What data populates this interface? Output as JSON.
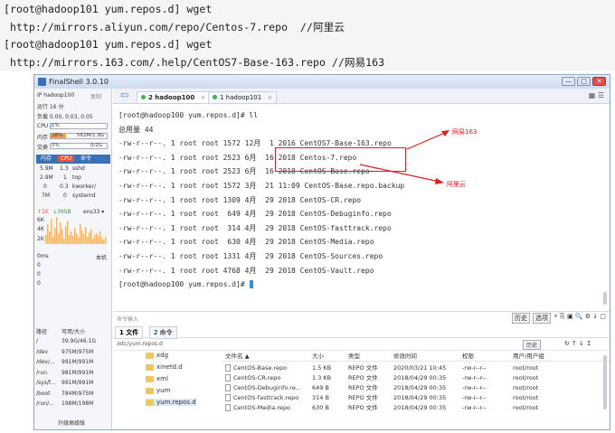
{
  "commands": [
    "[root@hadoop101 yum.repos.d] wget",
    " http://mirrors.aliyun.com/repo/Centos-7.repo  //阿里云",
    "[root@hadoop101 yum.repos.d] wget",
    " http://mirrors.163.com/.help/CentOS7-Base-163.repo //网易163"
  ],
  "window": {
    "title": "FinalShell 3.0.10",
    "min": "—",
    "max": "□",
    "close": "✕"
  },
  "sidebar": {
    "host": "IP hadoop100",
    "copy": "复制",
    "uptime": "运行 16 分",
    "load": "负载 0.00, 0.03, 0.05",
    "cpu_label": "CPU",
    "cpu_value": "1%",
    "cpu_pct": 1,
    "mem_label": "内存",
    "mem_pct_text": "28%",
    "mem_value": "562M/1.9G",
    "mem_pct": 28,
    "swap_label": "交换",
    "swap_pct_text": "0%",
    "swap_value": "0/2G",
    "swap_pct": 0,
    "proc_headers": [
      "内存",
      "CPU",
      "命令"
    ],
    "processes": [
      {
        "mem": "5.9M",
        "cpu": "1.3",
        "cmd": "sshd"
      },
      {
        "mem": "2.9M",
        "cpu": "1",
        "cmd": "top"
      },
      {
        "mem": "0",
        "cpu": "0.3",
        "cmd": "kworker/"
      },
      {
        "mem": "7M",
        "cpu": "0",
        "cmd": "systemd"
      }
    ],
    "net_up": "↑1K",
    "net_down": "↓395B",
    "net_if": "ens33 ▾",
    "net_scale": [
      "6K",
      "4K",
      "2K"
    ],
    "ping_label": "0ms",
    "ping_host": "本机",
    "ping_scale": [
      "0",
      "0",
      "0"
    ]
  },
  "tabs": [
    {
      "label": "2 hadoop100",
      "close": "×"
    },
    {
      "label": "1 hadoop101",
      "close": "×"
    }
  ],
  "terminal": {
    "lines": [
      "[root@hadoop100 yum.repos.d]# ll",
      "总用量 44",
      "-rw-r--r--. 1 root root 1572 12月  1 2016 CentOS7-Base-163.repo",
      "-rw-r--r--. 1 root root 2523 6月  16 2018 Centos-7.repo",
      "-rw-r--r--. 1 root root 2523 6月  16 2018 CentOS-Base.repo",
      "-rw-r--r--. 1 root root 1572 3月  21 11:09 CentOS-Base.repo.backup",
      "-rw-r--r--. 1 root root 1309 4月  29 2018 CentOS-CR.repo",
      "-rw-r--r--. 1 root root  649 4月  29 2018 CentOS-Debuginfo.repo",
      "-rw-r--r--. 1 root root  314 4月  29 2018 CentOS-fasttrack.repo",
      "-rw-r--r--. 1 root root  630 4月  29 2018 CentOS-Media.repo",
      "-rw-r--r--. 1 root root 1331 4月  29 2018 CentOS-Sources.repo",
      "-rw-r--r--. 1 root root 4768 4月  29 2018 CentOS-Vault.repo",
      "[root@hadoop100 yum.repos.d]# "
    ],
    "annotation_163": "网易163",
    "annotation_aliyun": "阿里云",
    "annotation_color": "#e02020"
  },
  "cmd_input": {
    "placeholder": "命令输入",
    "history": "历史",
    "options": "选项",
    "icons": "⚡ ⎘ ▣ 🔍 ⚙ ↓ ▢"
  },
  "file_tabs": [
    "1 文件",
    "2 命令"
  ],
  "path": {
    "value": "/etc/yum.repos.d",
    "history": "历史",
    "icons": "↻ ↑ ↓ ↥"
  },
  "disks": {
    "headers": [
      "路径",
      "可用/大小"
    ],
    "rows": [
      {
        "path": "/",
        "size": "39.9G/46.1G"
      },
      {
        "path": "/dev",
        "size": "975M/975M"
      },
      {
        "path": "/dev/...",
        "size": "991M/991M"
      },
      {
        "path": "/run",
        "size": "981M/991M"
      },
      {
        "path": "/sys/f...",
        "size": "991M/991M"
      },
      {
        "path": "/boot",
        "size": "784M/975M"
      },
      {
        "path": "/run/...",
        "size": "198M/198M"
      }
    ],
    "upgrade": "升级高级版"
  },
  "tree": [
    "xdg",
    "xinetd.d",
    "xml",
    "yum",
    "yum.repos.d"
  ],
  "files": {
    "headers": [
      "文件名 ▲",
      "大小",
      "类型",
      "修改时间",
      "权限",
      "用户/用户组"
    ],
    "rows": [
      [
        "CentOS-Base.repo",
        "1.5 KB",
        "REPO 文件",
        "2020/03/21 10:45",
        "-rw-r--r--",
        "root/root"
      ],
      [
        "CentOS-CR.repo",
        "1.3 KB",
        "REPO 文件",
        "2018/04/29 00:35",
        "-rw-r--r--",
        "root/root"
      ],
      [
        "CentOS-Debuginfo.re...",
        "649 B",
        "REPO 文件",
        "2018/04/29 00:35",
        "-rw-r--r--",
        "root/root"
      ],
      [
        "CentOS-fasttrack.repo",
        "314 B",
        "REPO 文件",
        "2018/04/29 00:35",
        "-rw-r--r--",
        "root/root"
      ],
      [
        "CentOS-Media.repo",
        "630 B",
        "REPO 文件",
        "2018/04/29 00:35",
        "-rw-r--r--",
        "root/root"
      ]
    ]
  }
}
